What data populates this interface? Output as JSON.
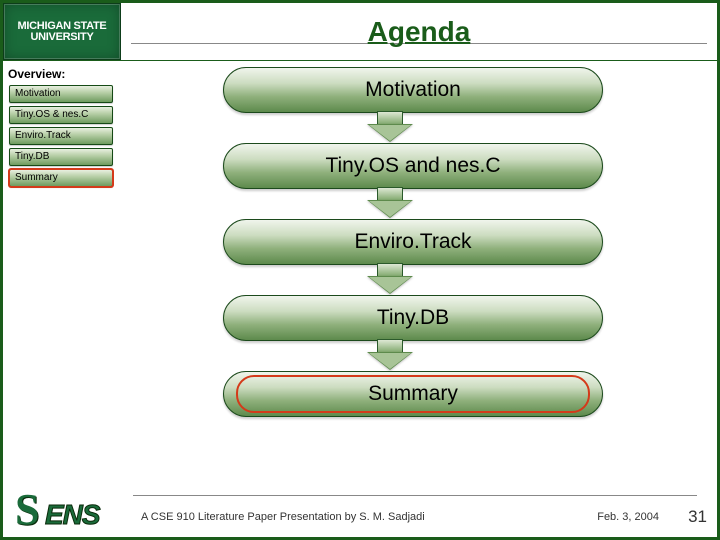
{
  "header": {
    "logo_line1": "MICHIGAN STATE",
    "logo_line2": "UNIVERSITY",
    "title": "Agenda"
  },
  "sidebar": {
    "heading": "Overview:",
    "items": [
      {
        "label": "Motivation",
        "highlight": false
      },
      {
        "label": "Tiny.OS & nes.C",
        "highlight": false
      },
      {
        "label": "Enviro.Track",
        "highlight": false
      },
      {
        "label": "Tiny.DB",
        "highlight": false
      },
      {
        "label": "Summary",
        "highlight": true
      }
    ]
  },
  "flow": {
    "stages": [
      {
        "label": "Motivation",
        "highlight": false
      },
      {
        "label": "Tiny.OS and nes.C",
        "highlight": false
      },
      {
        "label": "Enviro.Track",
        "highlight": false
      },
      {
        "label": "Tiny.DB",
        "highlight": false
      },
      {
        "label": "Summary",
        "highlight": true
      }
    ]
  },
  "footer": {
    "sens_logo_s": "S",
    "sens_logo_rest": "ENS",
    "credits": "A CSE 910 Literature Paper Presentation by S. M. Sadjadi",
    "date": "Feb. 3, 2004",
    "page": "31"
  }
}
